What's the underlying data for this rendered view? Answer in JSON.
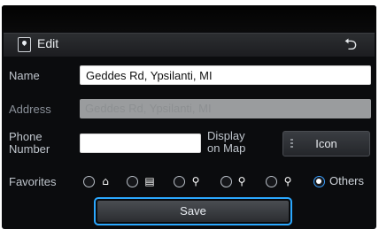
{
  "titlebar": {
    "title": "Edit",
    "back_glyph": "⮌"
  },
  "form": {
    "name": {
      "label": "Name",
      "value": "Geddes Rd, Ypsilanti, MI"
    },
    "address": {
      "label": "Address",
      "value": "Geddes Rd, Ypsilanti, MI"
    },
    "phone": {
      "label_line1": "Phone",
      "label_line2": "Number",
      "value": ""
    },
    "display_on_map": {
      "label_line1": "Display",
      "label_line2": "on Map"
    },
    "icon_button": {
      "label": "Icon"
    },
    "favorites": {
      "label": "Favorites",
      "options": [
        {
          "icon": "home-icon",
          "glyph": "⌂",
          "selected": false
        },
        {
          "icon": "building-icon",
          "glyph": "▤",
          "selected": false
        },
        {
          "icon": "person-star-1-icon",
          "glyph": "⚲",
          "selected": false
        },
        {
          "icon": "person-star-2-icon",
          "glyph": "⚲",
          "selected": false
        },
        {
          "icon": "person-star-3-icon",
          "glyph": "⚲",
          "selected": false
        },
        {
          "text": "Others",
          "selected": true
        }
      ]
    },
    "save": {
      "label": "Save"
    }
  },
  "colors": {
    "accent": "#2ba8ff",
    "background": "#0b0c0e"
  }
}
